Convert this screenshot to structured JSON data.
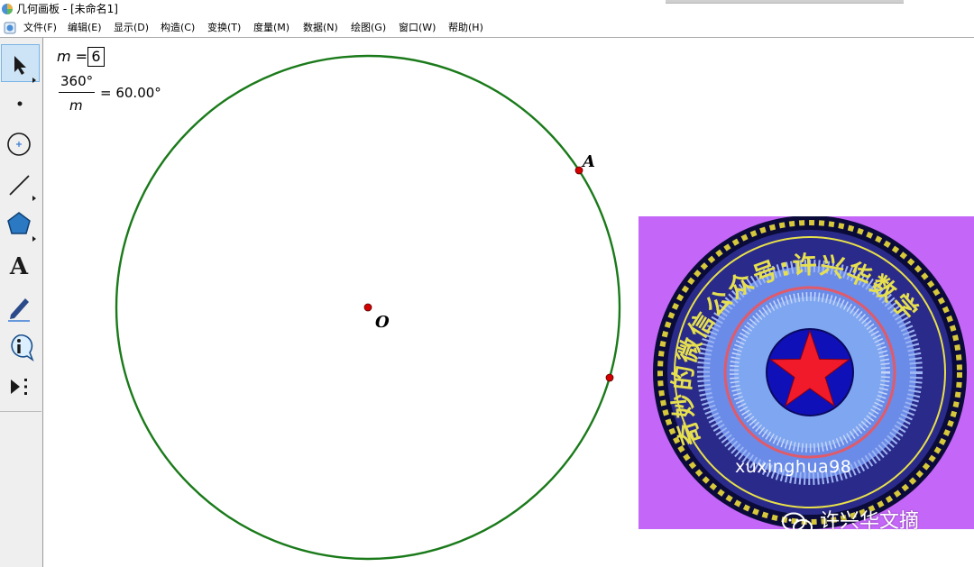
{
  "window": {
    "title": "几何画板 - [未命名1]"
  },
  "menu": [
    {
      "label": "文件(F)"
    },
    {
      "label": "编辑(E)"
    },
    {
      "label": "显示(D)"
    },
    {
      "label": "构造(C)"
    },
    {
      "label": "变换(T)"
    },
    {
      "label": "度量(M)"
    },
    {
      "label": "数据(N)"
    },
    {
      "label": "绘图(G)"
    },
    {
      "label": "窗口(W)"
    },
    {
      "label": "帮助(H)"
    }
  ],
  "toolbox": [
    {
      "name": "selection-arrow-tool",
      "icon": "arrow-icon",
      "selected": true
    },
    {
      "name": "point-tool",
      "icon": "point-icon"
    },
    {
      "name": "compass-tool",
      "icon": "circle-icon"
    },
    {
      "name": "straightedge-tool",
      "icon": "segment-icon"
    },
    {
      "name": "polygon-tool",
      "icon": "pentagon-icon"
    },
    {
      "name": "text-tool",
      "icon": "letter-a-icon",
      "glyph": "A"
    },
    {
      "name": "marker-tool",
      "icon": "pen-icon"
    },
    {
      "name": "information-tool",
      "icon": "info-icon"
    },
    {
      "name": "custom-tool",
      "icon": "play-more-icon"
    }
  ],
  "measurements": {
    "m_name": "m",
    "m_eq": " = ",
    "m_value": "6",
    "fraction_numerator": "360°",
    "fraction_denominator": "m",
    "fraction_result": "= 60.00°"
  },
  "points": {
    "center_label": "O",
    "point_a_label": "A"
  },
  "colors": {
    "circle": "#1a7a1a",
    "point": "#d40000",
    "promo_background": "#c466f7"
  },
  "promo": {
    "ring_text": "奇妙的微信公众号:许兴华数学",
    "handle": "xuxinghua98"
  },
  "watermark": {
    "icon": "wechat-icon",
    "text": "许兴华文摘"
  }
}
